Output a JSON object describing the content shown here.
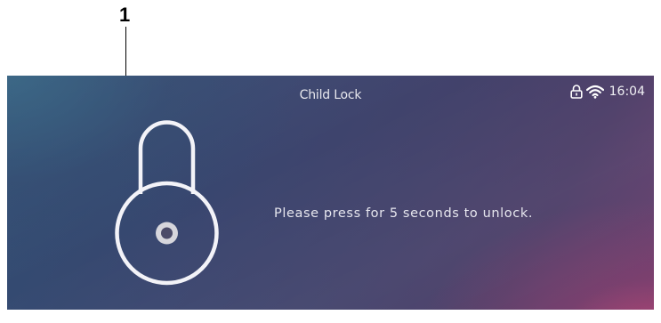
{
  "annotation": {
    "callout_number": "1"
  },
  "screen": {
    "title": "Child Lock",
    "status_bar": {
      "icons": [
        "lock-icon",
        "wifi-icon"
      ],
      "time": "16:04"
    },
    "lock_icon": "padlock-icon",
    "message": "Please press for 5 seconds to unlock."
  }
}
